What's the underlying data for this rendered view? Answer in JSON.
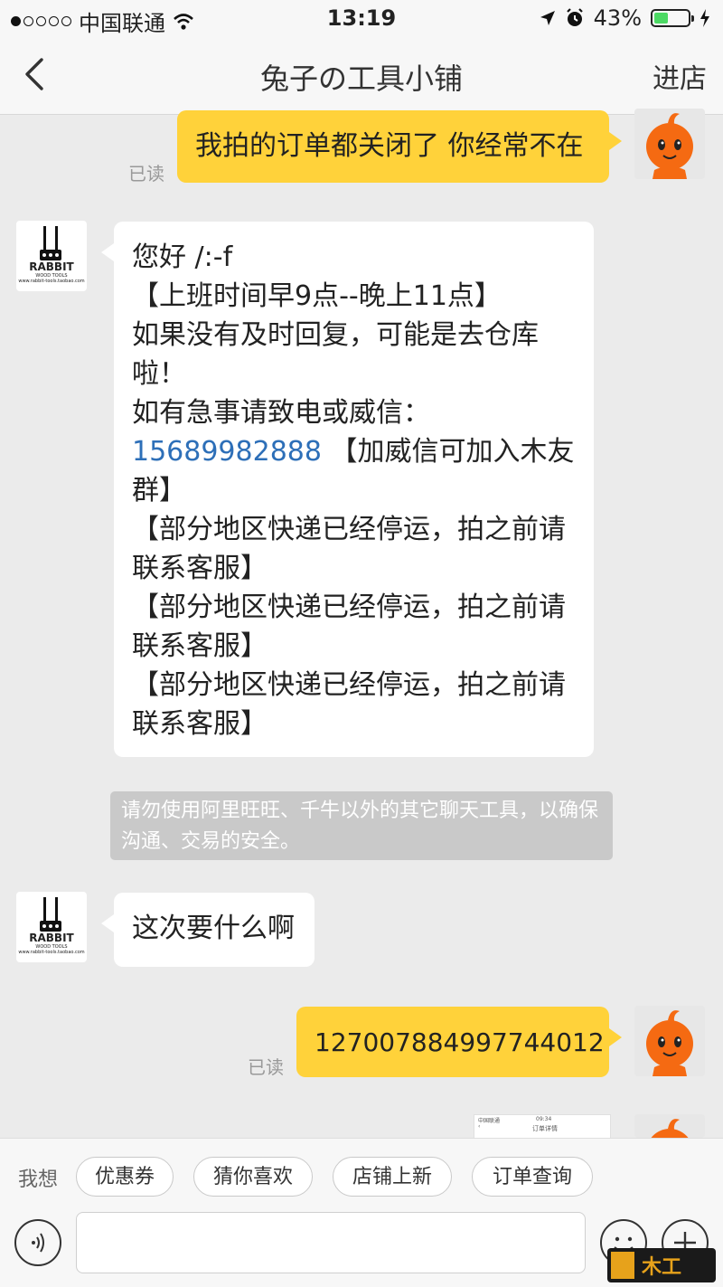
{
  "status_bar": {
    "carrier": "中国联通",
    "time": "13:19",
    "battery": "43%",
    "battery_level": 0.43
  },
  "nav": {
    "title": "兔子の工具小铺",
    "right_action": "进店"
  },
  "shop_logo": {
    "brand_text": "RABBIT",
    "small_text": "WOOD TOOLS",
    "url_text": "www.rabbit-tools.taobao.com"
  },
  "messages": [
    {
      "from": "me",
      "text": "我拍的订单都关闭了 你经常不在",
      "status": "已读"
    },
    {
      "from": "shop",
      "lines": [
        "您好 /:-f",
        "【上班时间早9点--晚上11点】",
        "如果没有及时回复，可能是去仓库",
        "啦！",
        "如有急事请致电或威信：",
        "群】",
        "【部分地区快递已经停运，拍之前请",
        "联系客服】",
        "【部分地区快递已经停运，拍之前请",
        "联系客服】",
        "【部分地区快递已经停运，拍之前请",
        "联系客服】"
      ],
      "phone": "15689982888",
      "phone_suffix": " 【加威信可加入木友"
    },
    {
      "from": "system",
      "text": "请勿使用阿里旺旺、千牛以外的其它聊天工具，以确保沟通、交易的安全。"
    },
    {
      "from": "shop",
      "text": "这次要什么啊"
    },
    {
      "from": "me",
      "text": "127007884997744012",
      "status": "已读"
    },
    {
      "from": "me",
      "type": "image",
      "preview_title": "订单详情",
      "preview_carrier": "中国联通",
      "preview_time": "09:34"
    }
  ],
  "quick_bar": {
    "prompt": "我想",
    "buttons": [
      "优惠券",
      "猜你喜欢",
      "店铺上新",
      "订单查询"
    ]
  },
  "colors": {
    "my_bubble": "#ffd23a",
    "their_bubble": "#ffffff",
    "background": "#ebebeb",
    "link": "#2d6fb8"
  },
  "watermark": "木工爱好者"
}
